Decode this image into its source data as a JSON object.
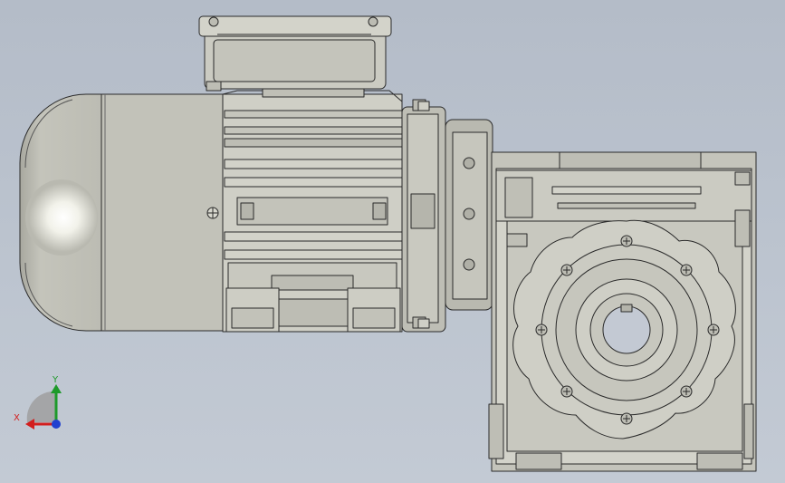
{
  "viewport": {
    "background_top": "#b4bcc8",
    "background_bottom": "#c3cad4"
  },
  "model": {
    "parts": [
      "motor-fan-cover",
      "motor-body",
      "terminal-box",
      "motor-flange",
      "worm-gearbox",
      "output-flange"
    ],
    "colors": {
      "body": "#c9c9c0",
      "body_dark": "#a9a99f",
      "outline": "#2a2a2a",
      "highlight": "#ffffff"
    }
  },
  "triad": {
    "x_label": "X",
    "y_label": "Y",
    "x_color": "#d21e1e",
    "y_color": "#1e9a2a",
    "z_color": "#2040d0"
  }
}
